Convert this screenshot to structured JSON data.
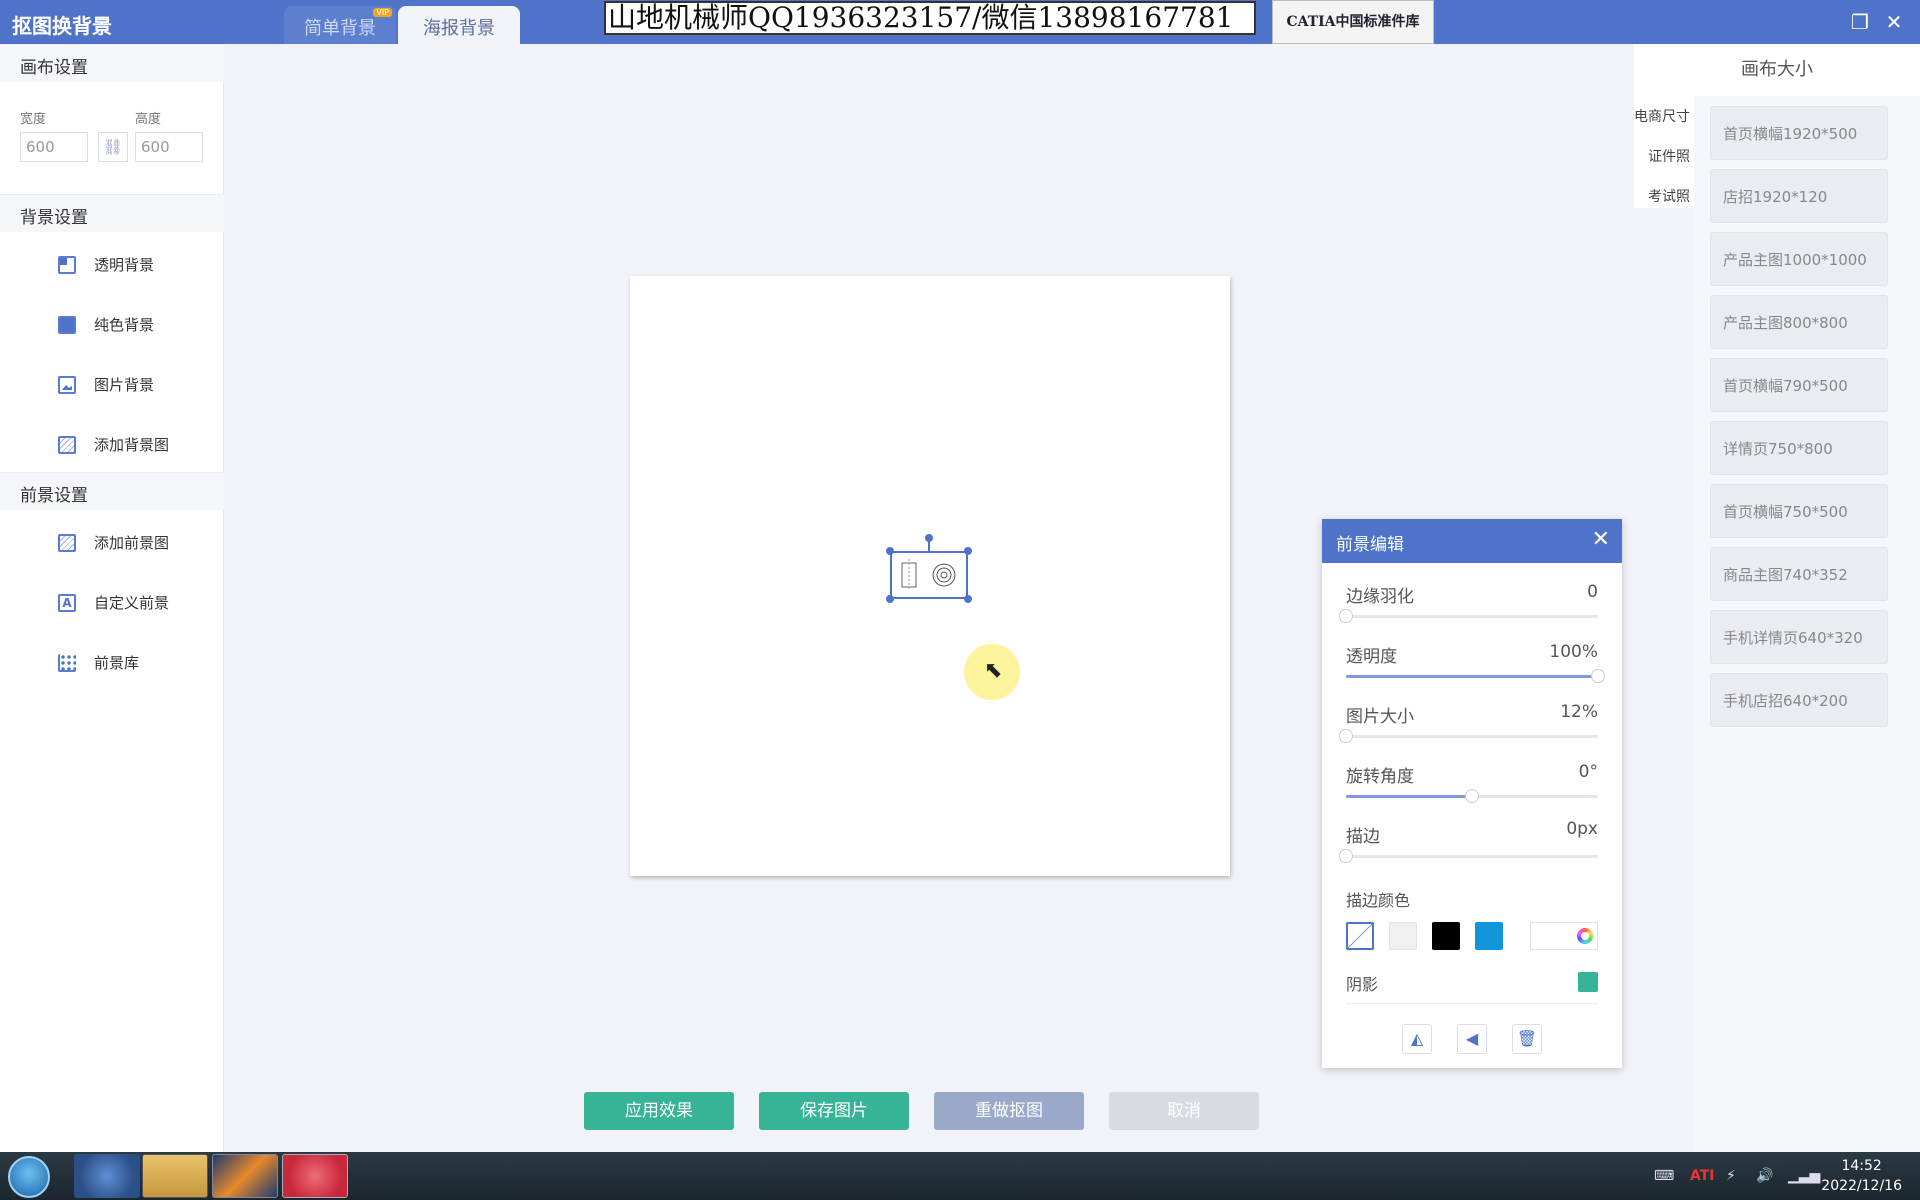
{
  "app": {
    "title": "抠图换背景",
    "tabs": [
      {
        "label": "简单背景",
        "badge": "VIP"
      },
      {
        "label": "海报背景"
      }
    ],
    "watermark_text": "山地机械师QQ1936323157/微信13898167781",
    "catia_button": "CATIA中国标准件库",
    "window_controls": [
      "restore-icon",
      "close-icon"
    ]
  },
  "canvas_settings": {
    "header": "画布设置",
    "width_label": "宽度",
    "height_label": "高度",
    "width_value": "600",
    "height_value": "600",
    "link_icon": "link-icon"
  },
  "background_settings": {
    "header": "背景设置",
    "items": [
      {
        "label": "透明背景",
        "icon": "transparent-bg-icon"
      },
      {
        "label": "纯色背景",
        "icon": "solid-bg-icon"
      },
      {
        "label": "图片背景",
        "icon": "image-bg-icon"
      },
      {
        "label": "添加背景图",
        "icon": "add-bg-image-icon"
      }
    ]
  },
  "foreground_settings": {
    "header": "前景设置",
    "items": [
      {
        "label": "添加前景图",
        "icon": "add-fg-image-icon"
      },
      {
        "label": "自定义前景",
        "icon": "custom-fg-icon"
      },
      {
        "label": "前景库",
        "icon": "fg-library-icon"
      }
    ]
  },
  "canvas_size": {
    "title": "画布大小",
    "categories": [
      "电商尺寸",
      "证件照",
      "考试照"
    ],
    "presets": [
      "首页横幅1920*500",
      "店招1920*120",
      "产品主图1000*1000",
      "产品主图800*800",
      "首页横幅790*500",
      "详情页750*800",
      "首页横幅750*500",
      "商品主图740*352",
      "手机详情页640*320",
      "手机店招640*200"
    ]
  },
  "fg_edit": {
    "title": "前景编辑",
    "sliders": [
      {
        "label": "边缘羽化",
        "value": "0",
        "fraction": 0
      },
      {
        "label": "透明度",
        "value": "100%",
        "fraction": 1
      },
      {
        "label": "图片大小",
        "value": "12%",
        "fraction": 0
      },
      {
        "label": "旋转角度",
        "value": "0°",
        "fraction": 0.5
      },
      {
        "label": "描边",
        "value": "0px",
        "fraction": 0
      }
    ],
    "stroke_color_label": "描边颜色",
    "stroke_colors": [
      "#ffffff",
      "#f0f0f0",
      "#000000",
      "#1296db"
    ],
    "shadow_label": "阴影",
    "shadow_color": "#37b396",
    "tools": [
      "flip-horizontal-icon",
      "flip-vertical-icon",
      "delete-icon"
    ]
  },
  "actions": {
    "apply": "应用效果",
    "save": "保存图片",
    "redo": "重做抠图",
    "cancel": "取消"
  },
  "taskbar": {
    "time": "14:52",
    "date": "2022/12/16"
  }
}
